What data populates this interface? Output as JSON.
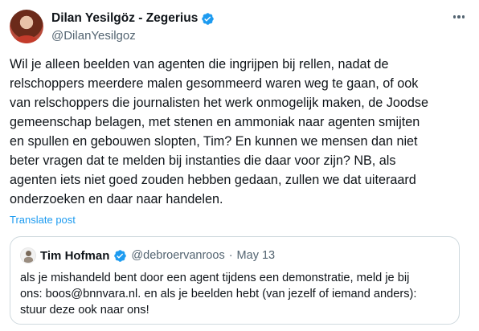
{
  "author": {
    "name": "Dilan Yesilgöz - Zegerius",
    "handle": "@DilanYesilgoz"
  },
  "tweet": {
    "text_lines": [
      "Wil je alleen beelden van agenten die ingrijpen bij rellen, nadat de",
      "relschoppers meerdere malen gesommeerd waren weg te gaan, of ook",
      "van relschoppers die journalisten het werk onmogelijk maken, de Joodse",
      "gemeenschap belagen, met stenen en ammoniak naar agenten smijten",
      "en spullen en gebouwen slopten, Tim? En kunnen we mensen dan niet",
      "beter vragen dat te melden bij instanties die daar voor zijn? NB, als",
      "agenten iets niet goed zouden hebben gedaan, zullen we dat uiteraard",
      "onderzoeken en daar naar handelen."
    ],
    "translate_label": "Translate post"
  },
  "quote": {
    "name": "Tim Hofman",
    "handle": "@debroervanroos",
    "separator": "·",
    "date": "May 13",
    "text_lines": [
      "als je mishandeld bent door een agent tijdens een demonstratie, meld je bij",
      "ons: boos@bnnvara.nl. en als je beelden hebt (van jezelf of iemand anders):",
      "stuur deze ook naar ons!"
    ]
  },
  "colors": {
    "verified": "#1d9bf0",
    "link": "#1d9bf0",
    "secondary_text": "#536471"
  },
  "icons": {
    "more": "more-horizontal-icon",
    "verified": "verified-badge-icon"
  }
}
